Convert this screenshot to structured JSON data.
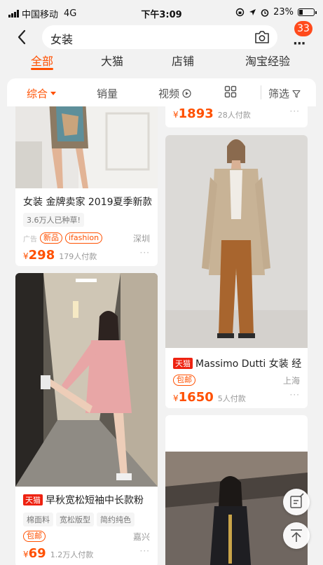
{
  "status_bar": {
    "carrier": "中国移动",
    "network": "4G",
    "time": "下午3:09",
    "battery": "23%"
  },
  "search": {
    "query": "女装",
    "notification_count": "33"
  },
  "tabs": [
    {
      "label": "全部",
      "active": true
    },
    {
      "label": "大猫"
    },
    {
      "label": "店铺"
    },
    {
      "label": "淘宝经验"
    }
  ],
  "sort": {
    "comprehensive": "综合",
    "sales": "销量",
    "video": "视频",
    "filter": "筛选"
  },
  "products": {
    "top_right": {
      "currency": "¥",
      "price": "1893",
      "paid": "28人付款"
    },
    "left1": {
      "title": "女装 金牌卖家 2019夏季新款",
      "chip": "3.6万人已种草!",
      "ad": "广告",
      "tag_new": "新品",
      "tag_brand": "ifashion",
      "location": "深圳",
      "currency": "¥",
      "price": "298",
      "paid": "179人付款"
    },
    "right1": {
      "tmall": "天猫",
      "title": "Massimo Dutti 女装 经",
      "tag": "包邮",
      "location": "上海",
      "currency": "¥",
      "price": "1650",
      "paid": "5人付款"
    },
    "left2": {
      "tmall": "天猫",
      "title": "早秋宽松短袖中长款粉",
      "chips": [
        "棉面料",
        "宽松版型",
        "简约纯色"
      ],
      "tag": "包邮",
      "location": "嘉兴",
      "currency": "¥",
      "price": "69",
      "paid": "1.2万人付款"
    }
  },
  "more_dots": "···",
  "colors": {
    "accent": "#ff5000",
    "tmall": "#ee1111",
    "badge": "#ff4a1c"
  },
  "icons": [
    "back-arrow-icon",
    "camera-icon",
    "more-icon",
    "play-icon",
    "grid-icon",
    "filter-icon",
    "edit-icon",
    "back-to-top-icon"
  ]
}
